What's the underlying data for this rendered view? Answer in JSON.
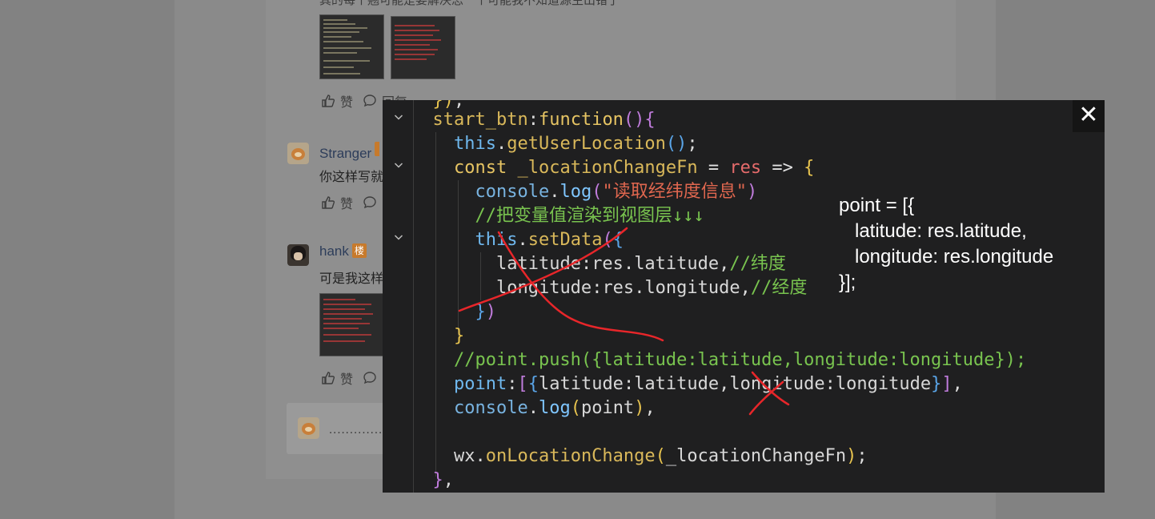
{
  "background": {
    "cut_text": "其的每个翘可能是要解决思一个可能我不知道源生出错了",
    "comments": [
      {
        "name": "Stranger",
        "text": "你这样写就",
        "like": "赞"
      },
      {
        "name": "hank",
        "badge": "楼",
        "text": "可是我这样",
        "like": "赞"
      }
    ],
    "top_actions": {
      "like": "赞",
      "reply": "回复"
    },
    "reply_placeholder": "..............."
  },
  "modal": {
    "close_label": "✕",
    "code_lines": [
      "  }),",
      "  start_btn:function(){",
      "    this.getUserLocation();",
      "    const _locationChangeFn = res => {",
      "      console.log(\"读取经纬度信息\")",
      "      //把变量值渲染到视图层↓↓↓",
      "      this.setData({",
      "        latitude:res.latitude,//纬度",
      "        longitude:res.longitude,//经度",
      "      })",
      "    }",
      "    //point.push({latitude:latitude,longitude:longitude});",
      "    point:[{latitude:latitude,longitude:longitude}],",
      "    console.log(point),",
      "",
      "    wx.onLocationChange(_locationChangeFn);",
      "  },"
    ],
    "note_text": "point = [{\n   latitude: res.latitude,\n   longitude: res.longitude\n}];",
    "annotation_color": "#e8262a"
  }
}
